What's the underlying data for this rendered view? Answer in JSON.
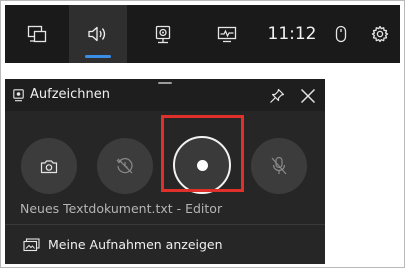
{
  "topbar": {
    "items": [
      {
        "icon": "widget-menu-icon"
      },
      {
        "icon": "audio-icon",
        "active": true
      },
      {
        "icon": "capture-icon"
      },
      {
        "icon": "performance-icon"
      }
    ],
    "clock": "11:12",
    "mouse_icon": "mouse-icon",
    "settings_icon": "gear-icon",
    "accent_color": "#3a8ee6"
  },
  "capture_widget": {
    "title": "Aufzeichnen",
    "title_icon": "capture-icon",
    "pin_icon": "pin-icon",
    "close_icon": "close-icon",
    "buttons": [
      {
        "name": "screenshot",
        "icon": "camera-icon"
      },
      {
        "name": "record-last",
        "icon": "rewind-clock-icon"
      },
      {
        "name": "start-recording",
        "icon": "record-dot-icon",
        "highlighted": true
      },
      {
        "name": "microphone",
        "icon": "mic-off-icon"
      }
    ],
    "highlight_color": "#e0302a",
    "app_name": "Neues Textdokument.txt - Editor",
    "gallery_link": "Meine Aufnahmen anzeigen",
    "gallery_icon": "gallery-icon"
  }
}
